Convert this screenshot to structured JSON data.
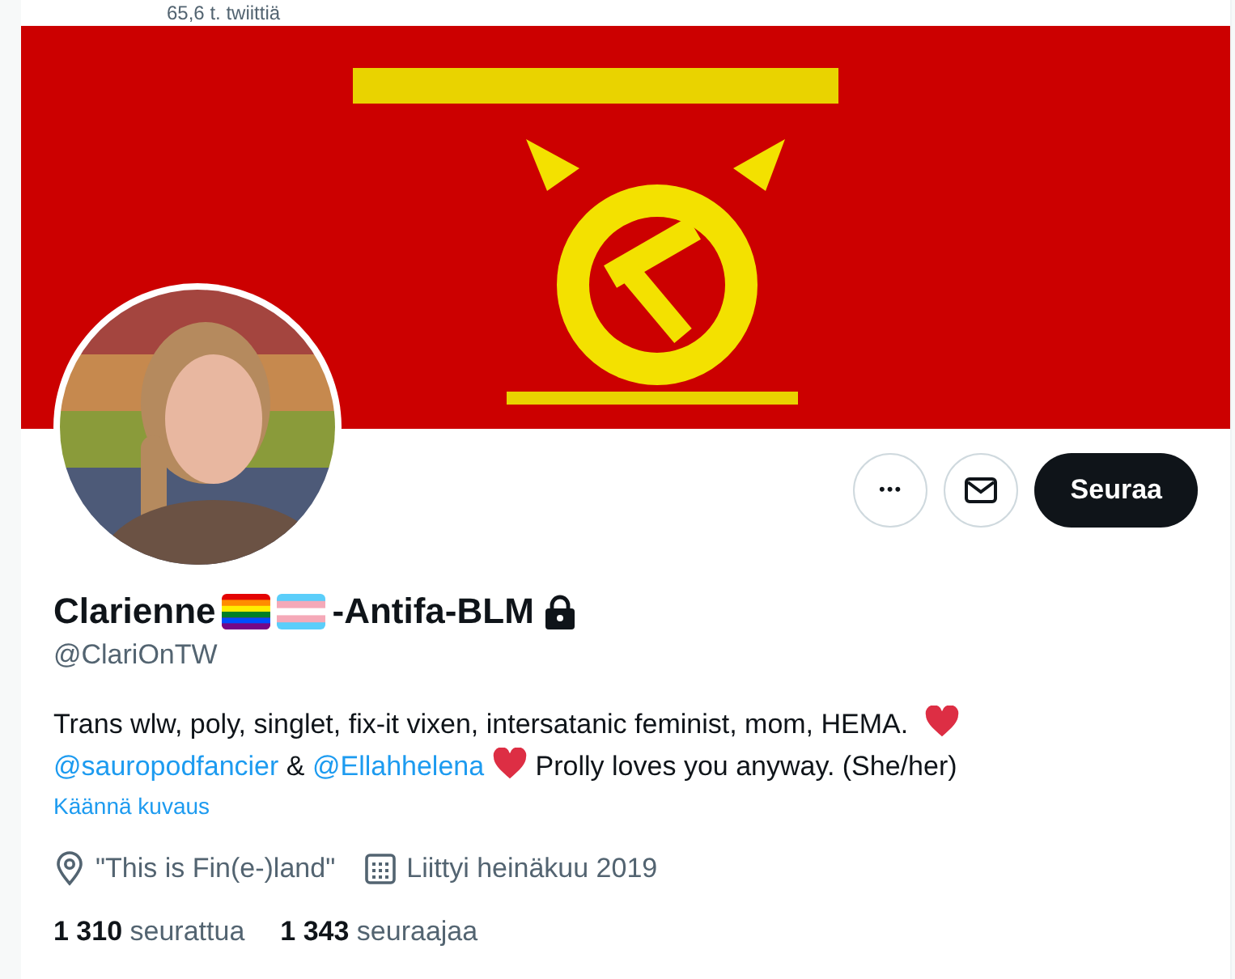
{
  "header": {
    "tweet_count": "65,6 t. twiittiä"
  },
  "actions": {
    "more": "•••",
    "follow": "Seuraa"
  },
  "profile": {
    "name_parts": [
      {
        "kind": "text",
        "text": "Clarienne"
      },
      {
        "kind": "rainbow-flag"
      },
      {
        "kind": "transgender-flag"
      },
      {
        "kind": "text",
        "text": "-Antifa-BLM"
      }
    ],
    "protected": true,
    "handle": "@ClariOnTW",
    "bio": [
      {
        "kind": "text",
        "text": "Trans wlw, poly, singlet, fix-it vixen, intersatanic feminist, mom, HEMA. "
      },
      {
        "kind": "heart"
      },
      {
        "kind": "break"
      },
      {
        "kind": "link",
        "text": "@sauropodfancier"
      },
      {
        "kind": "text",
        "text": " & "
      },
      {
        "kind": "link",
        "text": "@Ellahhelena"
      },
      {
        "kind": "heart"
      },
      {
        "kind": "text",
        "text": " Prolly loves you anyway. (She/her)"
      }
    ],
    "translate": "Käännä kuvaus",
    "location": "\"This is Fin(e-)land\"",
    "joined": "Liittyi heinäkuu 2019",
    "stats": [
      {
        "count": "1 310",
        "label": "seurattua"
      },
      {
        "count": "1 343",
        "label": "seuraajaa"
      }
    ]
  }
}
